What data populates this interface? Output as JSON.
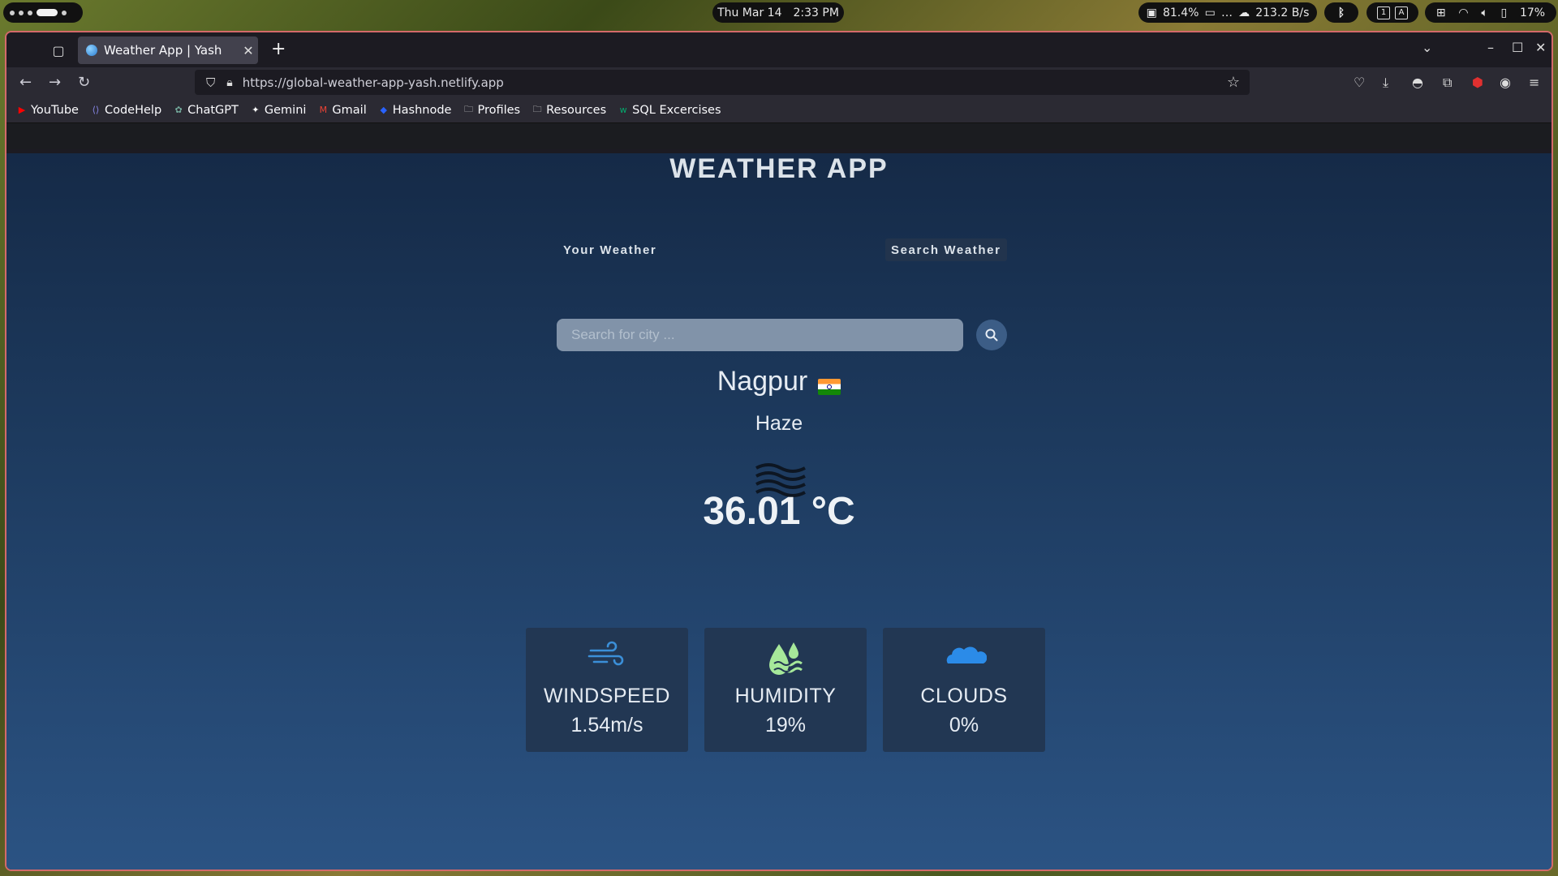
{
  "topbar": {
    "date": "Thu Mar 14",
    "time": "2:33 PM",
    "cpu": "81.4%",
    "network": "213.2 B/s",
    "network_prefix": "…",
    "battery": "17%",
    "kb_1": "1",
    "kb_a": "A",
    "p_icon": "ᛒ"
  },
  "browser": {
    "tab_title": "Weather App | Yash",
    "url": "https://global-weather-app-yash.netlify.app",
    "bookmarks": [
      {
        "label": "YouTube",
        "icon": "youtube-icon",
        "color": "#ff0000"
      },
      {
        "label": "CodeHelp",
        "icon": "codehelp-icon",
        "color": "#8a8af0"
      },
      {
        "label": "ChatGPT",
        "icon": "chatgpt-icon",
        "color": "#74aa9c"
      },
      {
        "label": "Gemini",
        "icon": "gemini-icon",
        "color": "#ffffff"
      },
      {
        "label": "Gmail",
        "icon": "gmail-icon",
        "color": "#ea4335"
      },
      {
        "label": "Hashnode",
        "icon": "hashnode-icon",
        "color": "#2962ff"
      },
      {
        "label": "Profiles",
        "icon": "folder-icon",
        "color": "#dddddd"
      },
      {
        "label": "Resources",
        "icon": "folder-icon",
        "color": "#dddddd"
      },
      {
        "label": "SQL Excercises",
        "icon": "w3-icon",
        "color": "#04aa6d"
      }
    ]
  },
  "app": {
    "title": "WEATHER APP",
    "tab_your": "Your Weather",
    "tab_search": "Search Weather",
    "search_placeholder": "Search for city ...",
    "city": "Nagpur",
    "description": "Haze",
    "temperature": "36.01 °C",
    "cards": [
      {
        "label": "WINDSPEED",
        "value": "1.54m/s",
        "icon": "wind-icon",
        "color": "#3b8fd8"
      },
      {
        "label": "HUMIDITY",
        "value": "19%",
        "icon": "humidity-icon",
        "color": "#a6e89a"
      },
      {
        "label": "CLOUDS",
        "value": "0%",
        "icon": "cloud-icon",
        "color": "#2b8be8"
      }
    ]
  }
}
